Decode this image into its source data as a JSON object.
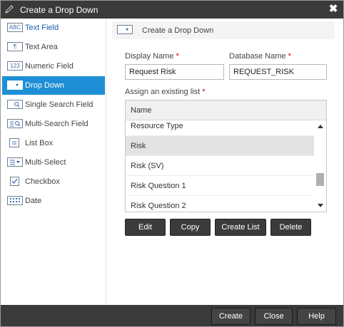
{
  "window": {
    "title": "Create a Drop Down",
    "close_glyph": "✖"
  },
  "sidebar": {
    "items": [
      {
        "label": "Text Field",
        "icon": "ABC",
        "icon_name": "text-field-icon",
        "active": false
      },
      {
        "label": "Text Area",
        "icon": "¶",
        "icon_name": "text-area-icon",
        "active": false
      },
      {
        "label": "Numeric Field",
        "icon": "123",
        "icon_name": "numeric-field-icon",
        "active": false
      },
      {
        "label": "Drop Down",
        "icon": "",
        "icon_name": "drop-down-icon",
        "active": true
      },
      {
        "label": "Single Search Field",
        "icon": "",
        "icon_name": "single-search-icon",
        "active": false
      },
      {
        "label": "Multi-Search Field",
        "icon": "",
        "icon_name": "multi-search-icon",
        "active": false
      },
      {
        "label": "List Box",
        "icon": "",
        "icon_name": "list-box-icon",
        "active": false
      },
      {
        "label": "Multi-Select",
        "icon": "",
        "icon_name": "multi-select-icon",
        "active": false
      },
      {
        "label": "Checkbox",
        "icon": "",
        "icon_name": "checkbox-icon",
        "active": false
      },
      {
        "label": "Date",
        "icon": "",
        "icon_name": "date-icon",
        "active": false
      }
    ]
  },
  "main": {
    "header": "Create a Drop Down",
    "display_name_label": "Display Name",
    "display_name_value": "Request Risk",
    "database_name_label": "Database Name",
    "database_name_value": "REQUEST_RISK",
    "required_mark": "*",
    "assign_label": "Assign an existing list",
    "list": {
      "column": "Name",
      "rows": [
        "Resource Type",
        "Risk",
        "Risk (SV)",
        "Risk Question 1",
        "Risk Question 2"
      ],
      "selected": "Risk"
    },
    "buttons": {
      "edit": "Edit",
      "copy": "Copy",
      "create_list": "Create List",
      "delete": "Delete"
    }
  },
  "footer": {
    "create": "Create",
    "close": "Close",
    "help": "Help"
  },
  "colors": {
    "titlebar": "#3a3a3a",
    "active_item": "#1e8fd6",
    "button": "#3b3b3b",
    "required": "#d40000"
  }
}
